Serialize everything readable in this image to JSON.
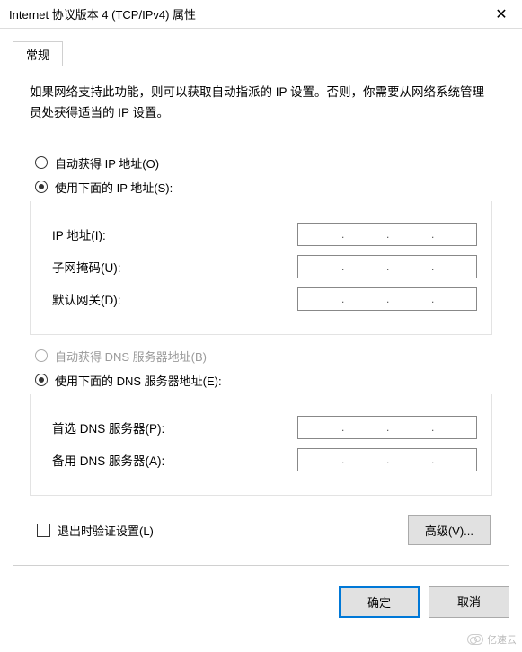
{
  "window": {
    "title": "Internet 协议版本 4 (TCP/IPv4) 属性",
    "close": "✕"
  },
  "tab": {
    "label": "常规"
  },
  "description": "如果网络支持此功能，则可以获取自动指派的 IP 设置。否则，你需要从网络系统管理员处获得适当的 IP 设置。",
  "ip": {
    "auto_label": "自动获得 IP 地址(O)",
    "manual_label": "使用下面的 IP 地址(S):",
    "selected": "manual",
    "fields": {
      "address_label": "IP 地址(I):",
      "subnet_label": "子网掩码(U):",
      "gateway_label": "默认网关(D):",
      "address": "",
      "subnet": "",
      "gateway": ""
    }
  },
  "dns": {
    "auto_label": "自动获得 DNS 服务器地址(B)",
    "auto_enabled": false,
    "manual_label": "使用下面的 DNS 服务器地址(E):",
    "selected": "manual",
    "fields": {
      "preferred_label": "首选 DNS 服务器(P):",
      "alternate_label": "备用 DNS 服务器(A):",
      "preferred": "",
      "alternate": ""
    }
  },
  "validate": {
    "label": "退出时验证设置(L)",
    "checked": false
  },
  "buttons": {
    "advanced": "高级(V)...",
    "ok": "确定",
    "cancel": "取消"
  },
  "watermark": "亿速云"
}
